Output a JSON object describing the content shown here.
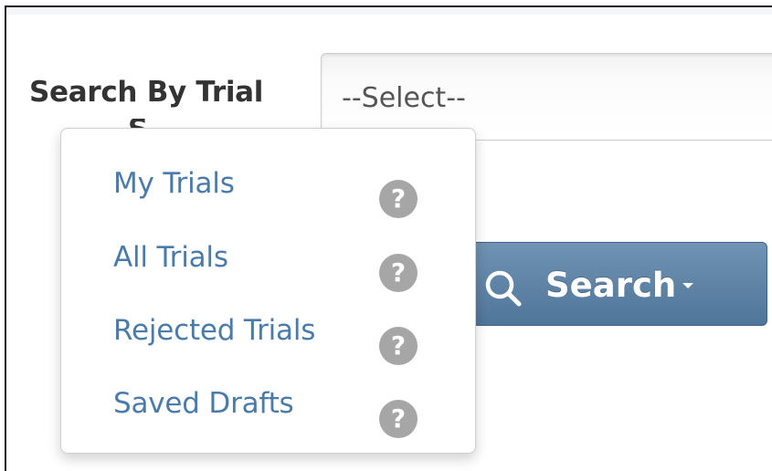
{
  "search_form": {
    "label": "Search By Trial",
    "label_overflow": "S",
    "select": {
      "value": "--Select--"
    },
    "search_button": {
      "label": "Search",
      "icon": "search-icon",
      "caret_icon": "caret-down-icon"
    }
  },
  "dropdown_menu": {
    "items": [
      {
        "label": "My Trials",
        "help_icon": "?"
      },
      {
        "label": "All Trials",
        "help_icon": "?"
      },
      {
        "label": "Rejected Trials",
        "help_icon": "?"
      },
      {
        "label": "Saved Drafts",
        "help_icon": "?"
      }
    ]
  },
  "colors": {
    "link": "#4a7bab",
    "button": "#5b80a3",
    "help_icon": "#a6a6a6",
    "label": "#333333"
  }
}
